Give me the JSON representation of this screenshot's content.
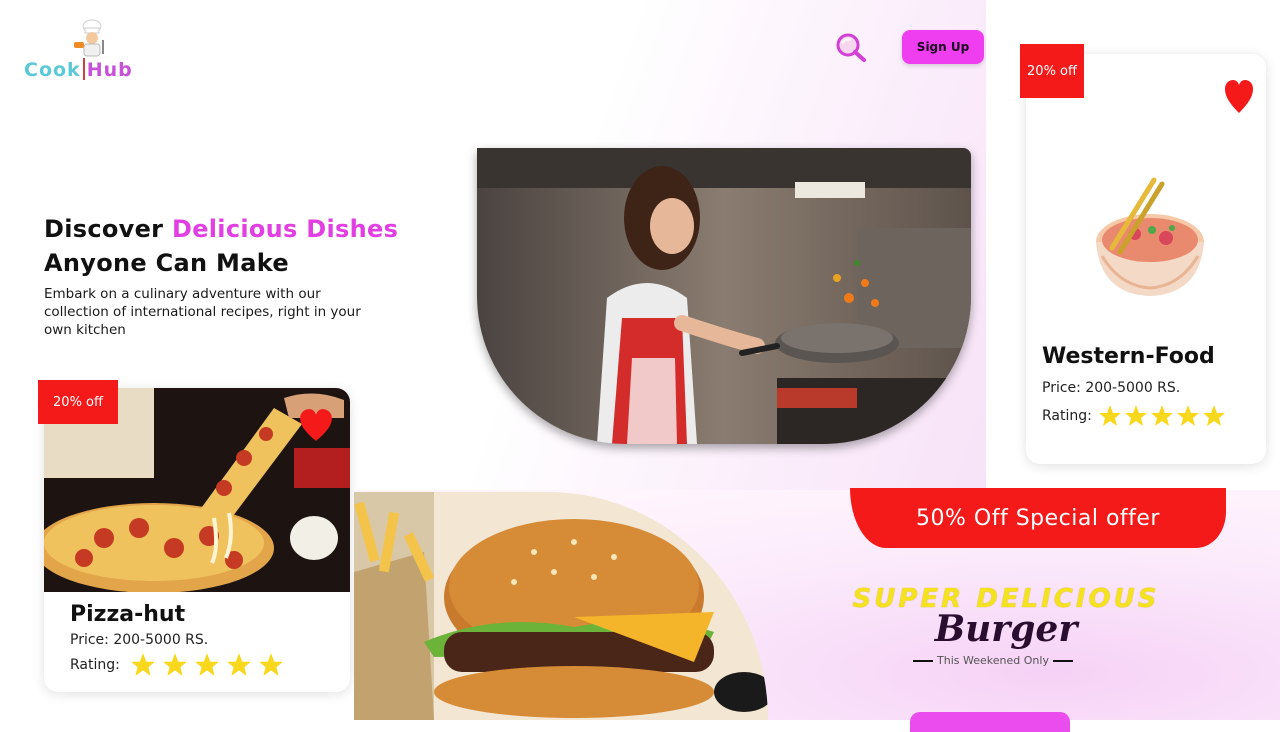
{
  "brand": {
    "cook": "Cook",
    "hub": "Hub"
  },
  "header": {
    "signup_label": "Sign Up"
  },
  "hero": {
    "headline_part1": "Discover ",
    "headline_accent": "Delicious Dishes",
    "headline_line2": "Anyone Can Make",
    "description": "Embark on a culinary adventure with our collection of international recipes, right in your own kitchen"
  },
  "cards": [
    {
      "badge": "20% off",
      "title": "Western-Food",
      "price": "Price: 200-5000 RS.",
      "rating_label": "Rating:",
      "stars": 5
    },
    {
      "badge": "20% off",
      "title": "Pizza-hut",
      "price": "Price: 200-5000 RS.",
      "rating_label": "Rating:",
      "stars": 5
    }
  ],
  "promo": {
    "ribbon": "50% Off Special offer",
    "super": "SUPER DELICIOUS",
    "product": "Burger",
    "note": "This Weekened Only"
  },
  "colors": {
    "accent": "#e23fe3",
    "badge_red": "#f41a1a",
    "star": "#f7d81d",
    "signup": "#ee3ef0"
  }
}
